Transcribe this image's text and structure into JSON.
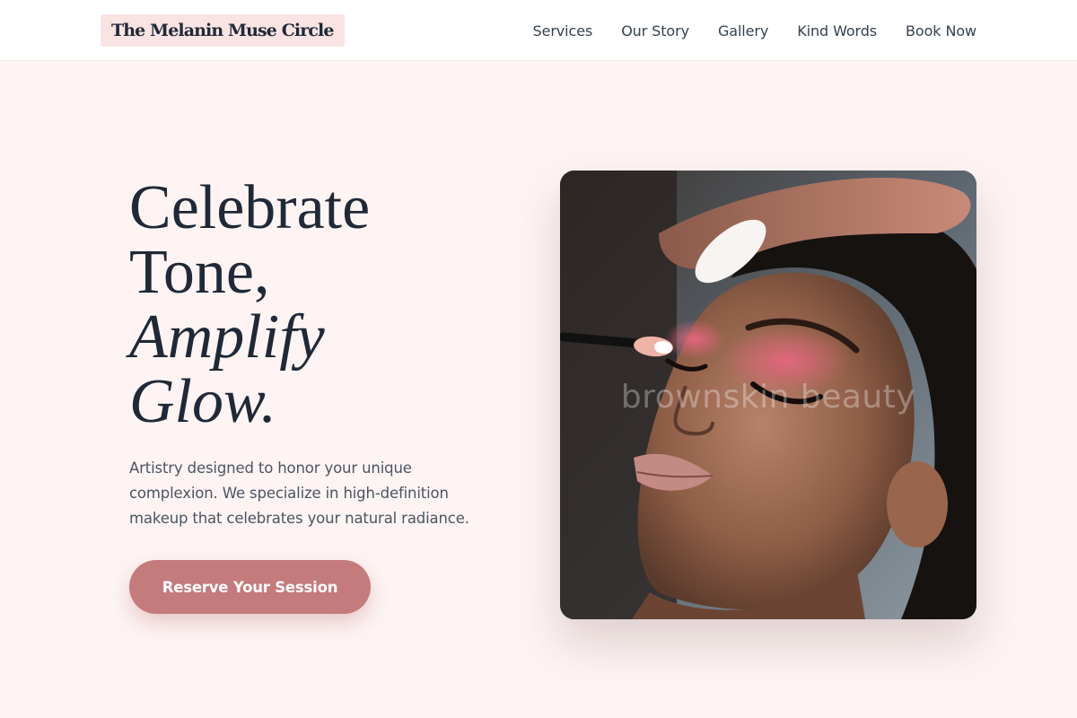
{
  "header": {
    "logo": "The Melanin Muse Circle",
    "nav": [
      "Services",
      "Our Story",
      "Gallery",
      "Kind Words",
      "Book Now"
    ]
  },
  "hero": {
    "title_lines": [
      "Celebrate",
      "Tone,",
      "Amplify",
      "Glow."
    ],
    "subtitle": "Artistry designed to honor your unique complexion. We specialize in high-definition makeup that celebrates your natural radiance.",
    "cta": "Reserve Your Session",
    "image": {
      "subject": "makeup-artist-applying-pink-eyeshadow",
      "watermark": "brownskin beauty"
    }
  },
  "colors": {
    "page_bg": "#fdf4f3",
    "header_bg": "#ffffff",
    "logo_bg": "#f9e4e3",
    "accent": "#c47b7b",
    "heading": "#1f2937",
    "body_text": "#4b5563"
  }
}
